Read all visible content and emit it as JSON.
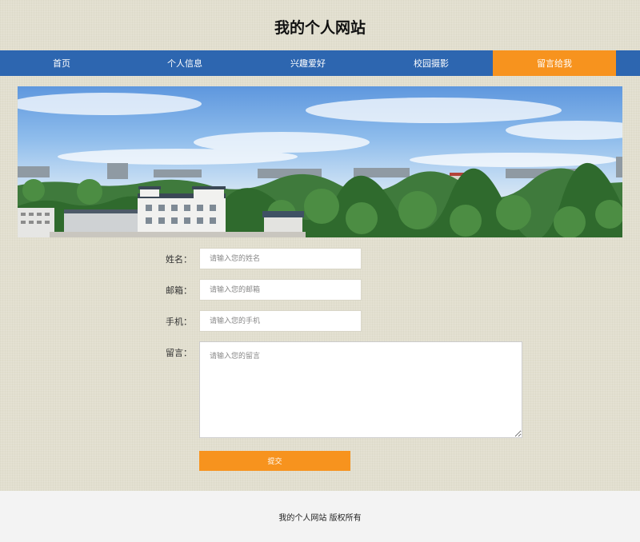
{
  "site": {
    "title": "我的个人网站"
  },
  "nav": {
    "items": [
      {
        "label": "首页"
      },
      {
        "label": "个人信息"
      },
      {
        "label": "兴趣爱好"
      },
      {
        "label": "校园摄影"
      },
      {
        "label": "留言给我"
      }
    ],
    "active_index": 4,
    "colors": {
      "bar": "#2d66b0",
      "active": "#f7931e"
    }
  },
  "banner": {
    "description": "campus panorama photo"
  },
  "form": {
    "name": {
      "label": "姓名：",
      "placeholder": "请输入您的姓名"
    },
    "email": {
      "label": "邮箱：",
      "placeholder": "请输入您的邮箱"
    },
    "phone": {
      "label": "手机：",
      "placeholder": "请输入您的手机"
    },
    "message": {
      "label": "留言：",
      "placeholder": "请输入您的留言"
    },
    "submit_label": "提交"
  },
  "footer": {
    "text": "我的个人网站 版权所有"
  }
}
